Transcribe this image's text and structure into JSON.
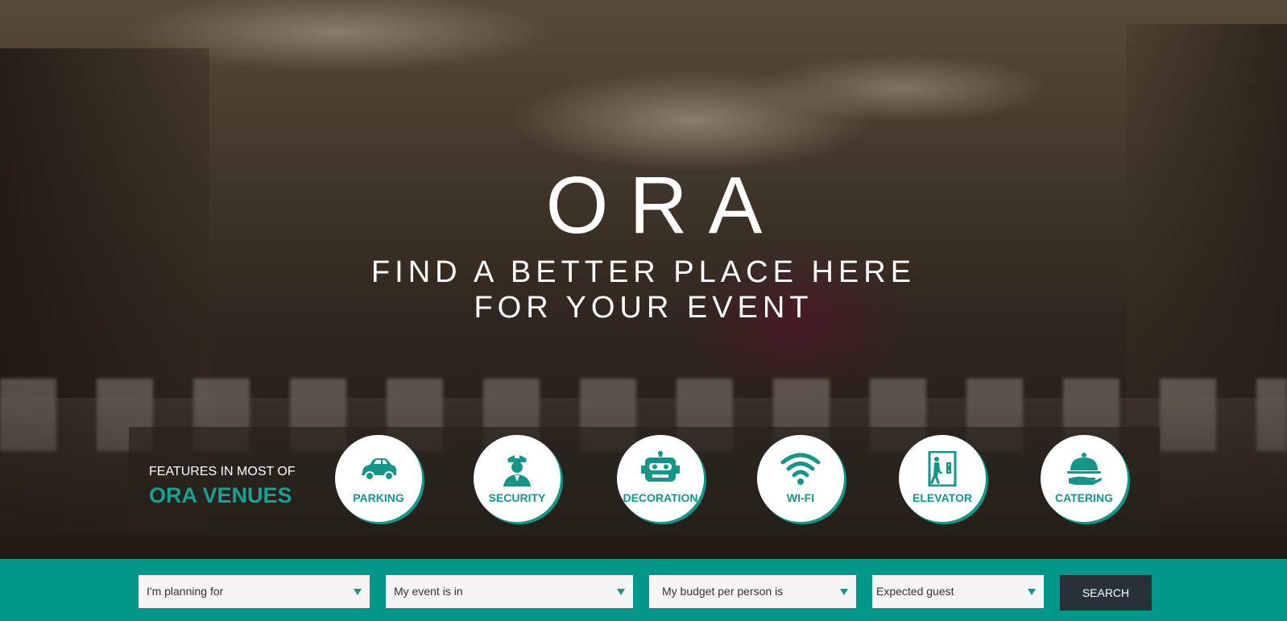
{
  "brand": {
    "title": "ORA"
  },
  "hero": {
    "tagline_line1": "FIND A BETTER PLACE HERE",
    "tagline_line2": "FOR YOUR EVENT"
  },
  "features": {
    "heading_sub": "FEATURES IN MOST OF",
    "heading_main": "ORA VENUES",
    "items": [
      {
        "label": "PARKING",
        "icon": "car-icon"
      },
      {
        "label": "SECURITY",
        "icon": "security-guard-icon"
      },
      {
        "label": "DECORATION",
        "icon": "robot-icon"
      },
      {
        "label": "WI-FI",
        "icon": "wifi-icon"
      },
      {
        "label": "ELEVATOR",
        "icon": "elevator-icon"
      },
      {
        "label": "CATERING",
        "icon": "cloche-icon"
      }
    ]
  },
  "search": {
    "planning_for": "I'm planning for",
    "event_in": "My event is in",
    "budget": "My budget per person is",
    "guests": "Expected guest",
    "button_label": "SEARCH"
  },
  "colors": {
    "accent": "#009688",
    "button": "#263238"
  }
}
